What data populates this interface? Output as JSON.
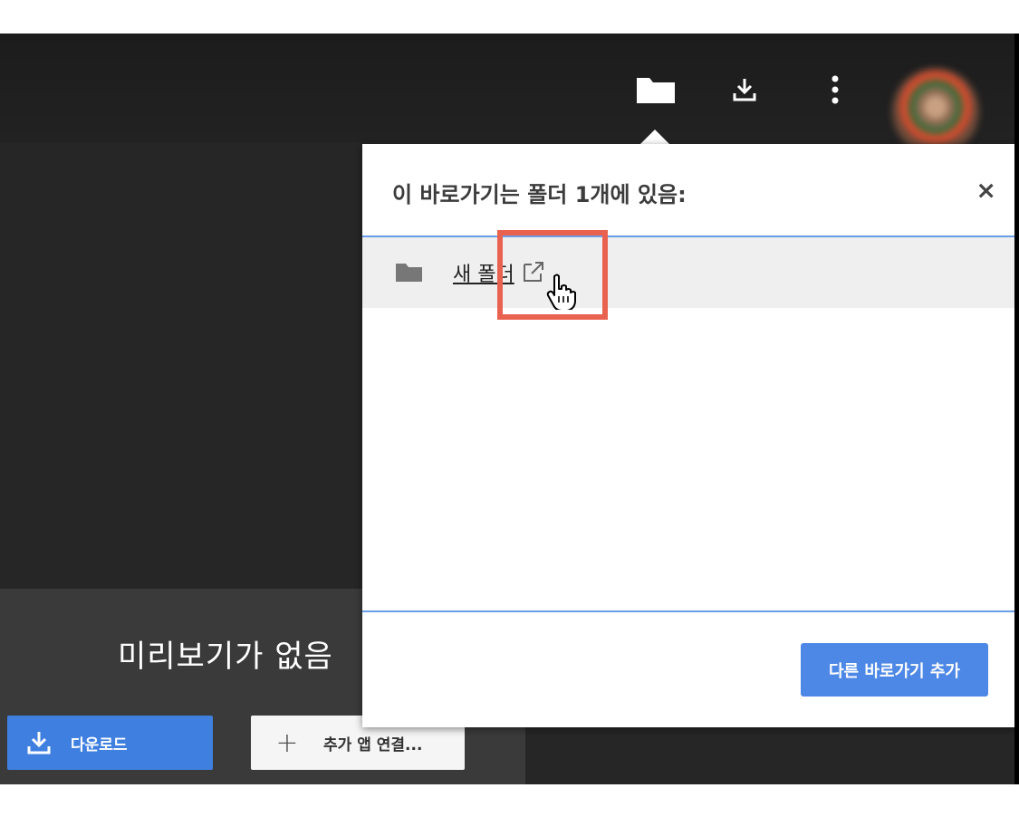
{
  "viewer": {
    "no_preview_text": "미리보기가 없음",
    "download_label": "다운로드",
    "connect_label": "추가 앱 연결..."
  },
  "toolbar": {
    "icons": [
      "folder-icon",
      "download-icon",
      "more-vert-icon",
      "avatar"
    ]
  },
  "popup": {
    "title": "이 바로가기는 폴더 1개에 있음:",
    "close": "×",
    "items": [
      {
        "name": "새 폴더",
        "icon": "folder-icon",
        "open_icon": "open-in-new-icon"
      }
    ],
    "add_button": "다른 바로가기 추가"
  },
  "colors": {
    "accent_blue": "#3f7fe0",
    "divider_blue": "#6a9ee8",
    "highlight_red": "#e8624f",
    "dark_bg": "#262626"
  }
}
